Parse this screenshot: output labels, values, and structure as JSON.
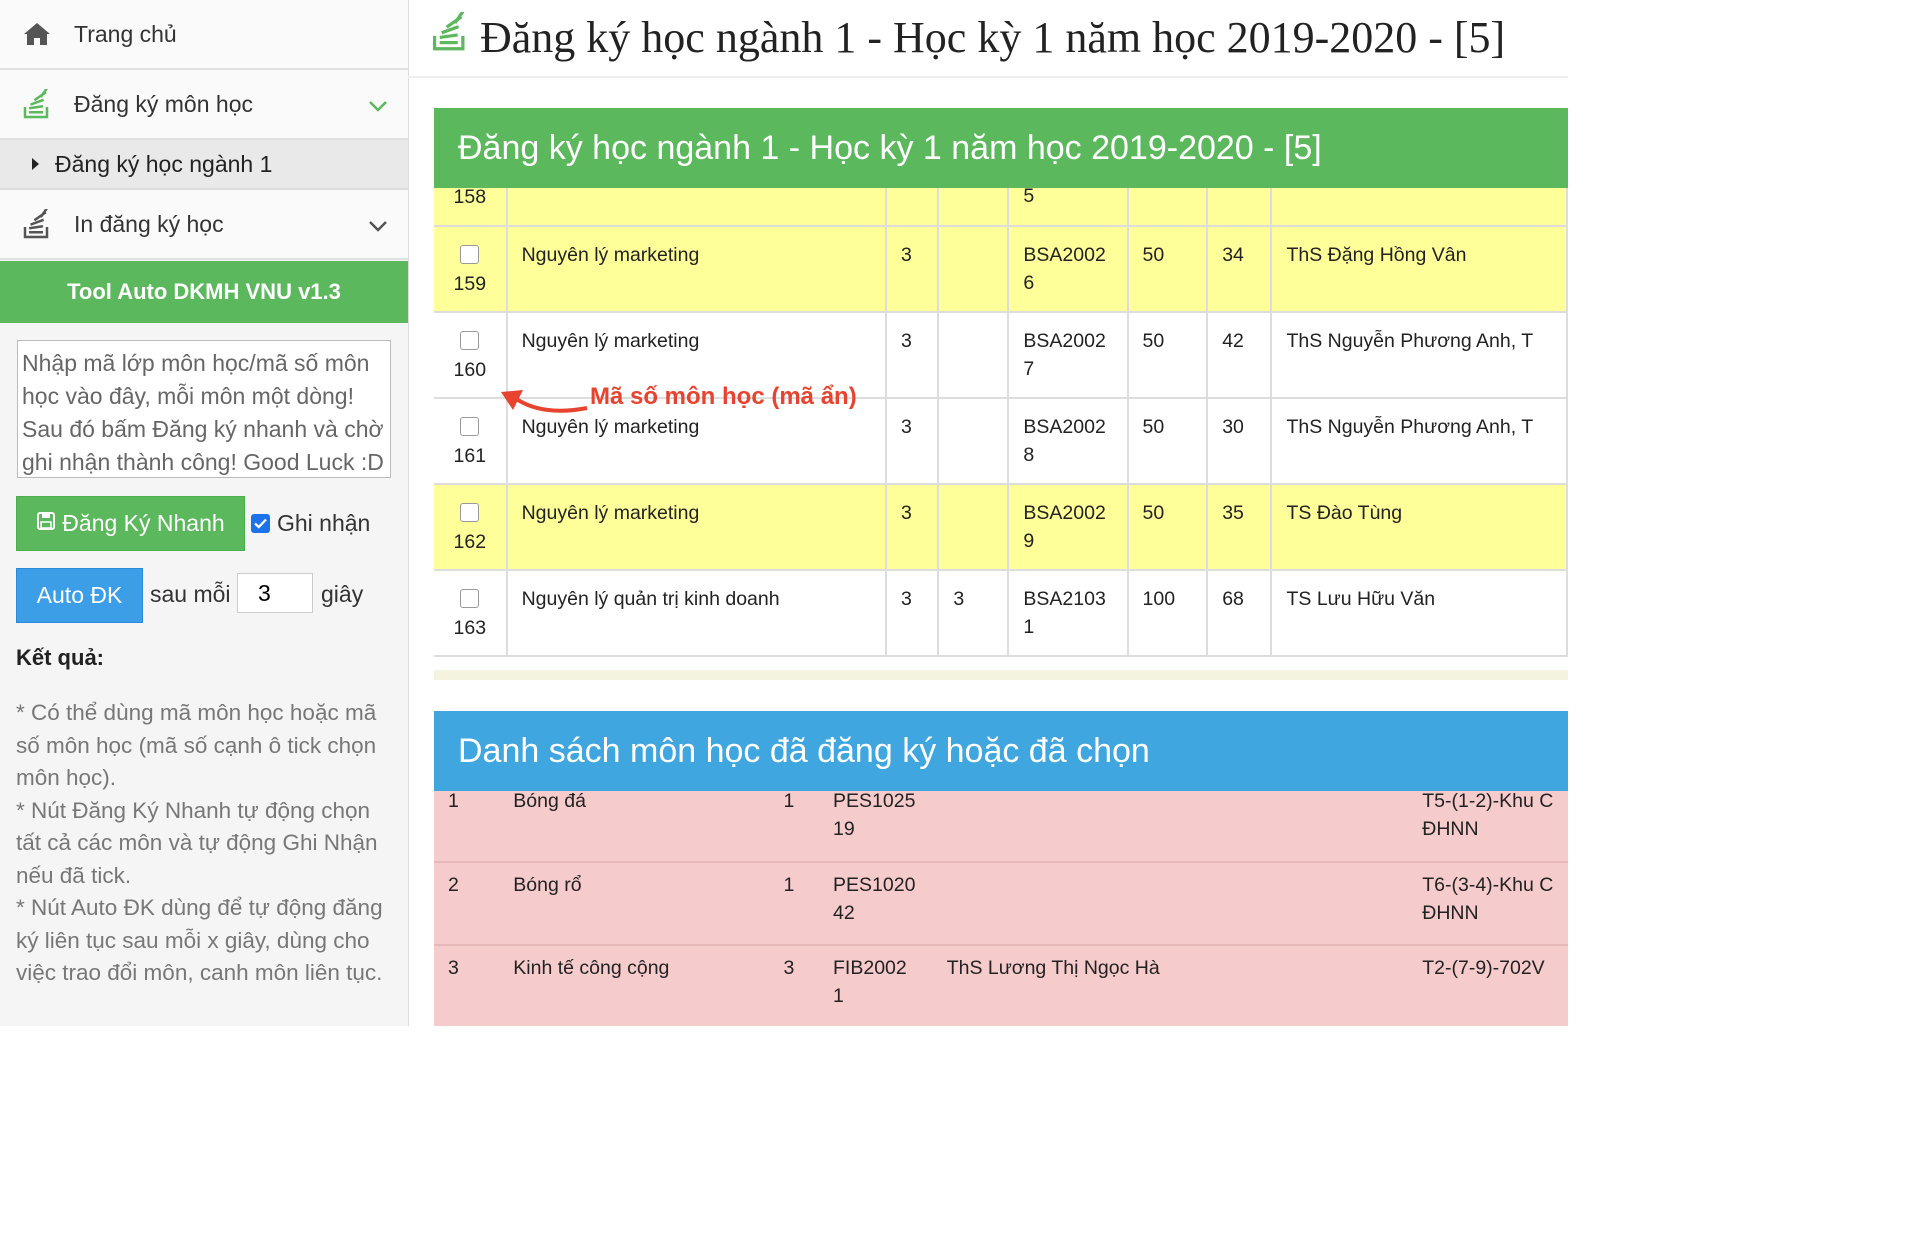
{
  "sidebar": {
    "home": "Trang chủ",
    "register": "Đăng ký môn học",
    "register_major": "Đăng ký học ngành 1",
    "print": "In đăng ký học",
    "tool_title": "Tool Auto DKMH VNU v1.3",
    "codes_placeholder": "Nhập mã lớp môn học/mã số môn học vào đây, mỗi môn một dòng! Sau đó bấm Đăng ký nhanh và chờ ghi nhận thành công! Good Luck :D",
    "fast_button": "Đăng Ký Nhanh",
    "record_label": "Ghi nhận",
    "auto_button": "Auto ĐK",
    "every_label": "sau mỗi",
    "seconds_value": "3",
    "seconds_label": "giây",
    "result_label": "Kết quả:",
    "notes": [
      "* Có thể dùng mã môn học hoặc mã số môn học (mã số cạnh ô tick chọn môn học).",
      "* Nút Đăng Ký Nhanh tự động chọn tất cả các môn và tự động Ghi Nhận nếu đã tick.",
      "* Nút Auto ĐK dùng để tự động đăng ký liên tục sau mỗi x giây, dùng cho việc trao đổi môn, canh môn liên tục."
    ]
  },
  "main": {
    "page_title": "Đăng ký học ngành 1 - Học kỳ 1 năm học 2019-2020 - [5]",
    "panel1_title": "Đăng ký học ngành 1 - Học kỳ 1 năm học 2019-2020 - [5]",
    "panel2_title": "Danh sách môn học đã đăng ký hoặc đã chọn",
    "annotation": "Mã số môn học (mã ẩn)"
  },
  "courses": [
    {
      "no": "158",
      "name": "",
      "credits": "",
      "x": "",
      "code1": "",
      "code2": "5",
      "cap": "",
      "reg": "",
      "teacher": "",
      "style": "y"
    },
    {
      "no": "159",
      "name": "Nguyên lý marketing",
      "credits": "3",
      "x": "",
      "code1": "BSA2002",
      "code2": "6",
      "cap": "50",
      "reg": "34",
      "teacher": "ThS Đặng Hồng Vân",
      "style": "y"
    },
    {
      "no": "160",
      "name": "Nguyên lý marketing",
      "credits": "3",
      "x": "",
      "code1": "BSA2002",
      "code2": "7",
      "cap": "50",
      "reg": "42",
      "teacher": "ThS Nguyễn Phương Anh, T",
      "style": "w"
    },
    {
      "no": "161",
      "name": "Nguyên lý marketing",
      "credits": "3",
      "x": "",
      "code1": "BSA2002",
      "code2": "8",
      "cap": "50",
      "reg": "30",
      "teacher": "ThS Nguyễn Phương Anh, T",
      "style": "w"
    },
    {
      "no": "162",
      "name": "Nguyên lý marketing",
      "credits": "3",
      "x": "",
      "code1": "BSA2002",
      "code2": "9",
      "cap": "50",
      "reg": "35",
      "teacher": "TS Đào Tùng",
      "style": "y"
    },
    {
      "no": "163",
      "name": "Nguyên lý quản trị kinh doanh",
      "credits": "3",
      "x": "3",
      "code1": "BSA2103",
      "code2": "1",
      "cap": "100",
      "reg": "68",
      "teacher": "TS Lưu Hữu Văn",
      "style": "w"
    }
  ],
  "registered": [
    {
      "no": "1",
      "name": "Bóng đá",
      "credits": "1",
      "code1": "PES1025",
      "code2": "19",
      "teacher": "",
      "sched1": "T5-(1-2)-Khu C",
      "sched2": "ĐHNN"
    },
    {
      "no": "2",
      "name": "Bóng rổ",
      "credits": "1",
      "code1": "PES1020",
      "code2": "42",
      "teacher": "",
      "sched1": "T6-(3-4)-Khu C",
      "sched2": "ĐHNN"
    },
    {
      "no": "3",
      "name": "Kinh tế công cộng",
      "credits": "3",
      "code1": "FIB2002",
      "code2": "1",
      "teacher": "ThS Lương Thị Ngọc Hà",
      "sched1": "T2-(7-9)-702V",
      "sched2": ""
    }
  ],
  "colors": {
    "green": "#5cb85c",
    "blue": "#3fa6df",
    "yellow_row": "#ffff99",
    "pink_row": "#f6cbcb",
    "annotation": "#e8432e"
  }
}
